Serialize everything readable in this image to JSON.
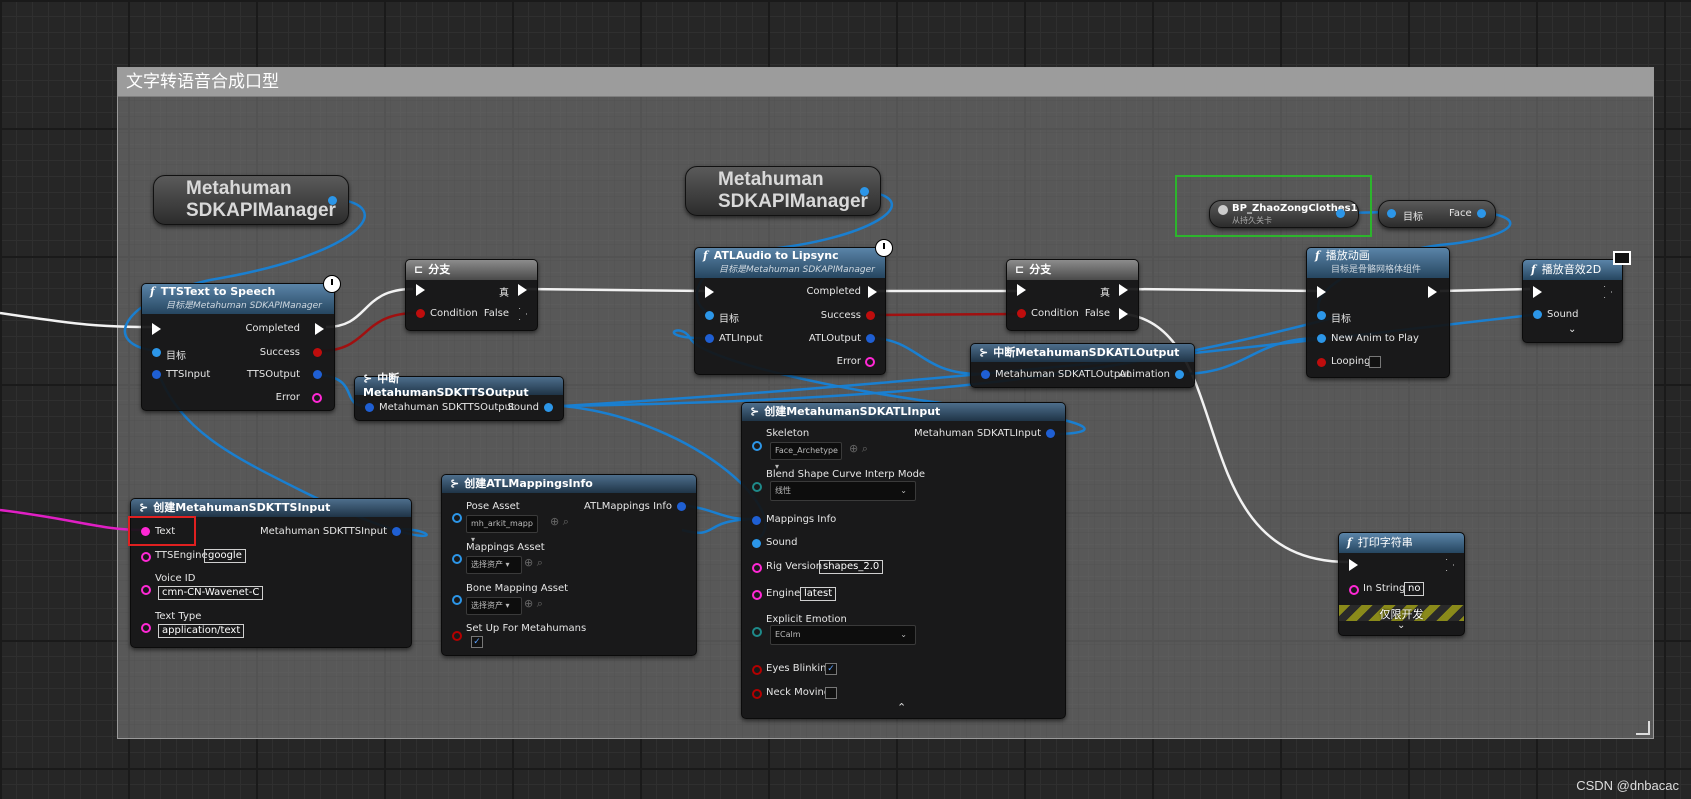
{
  "comment_title": "文字转语音合成口型",
  "watermark": "CSDN @dnbacac",
  "colors": {
    "exec": "#ffffff",
    "object": "#2c96e8",
    "string": "#ff28d5",
    "bool": "#bf0d0d",
    "struct": "#1f5fd3",
    "selection": "#2cb52c",
    "highlight": "#e02020"
  },
  "var_manager_1": {
    "line1": "Metahuman",
    "line2": "SDKAPIManager"
  },
  "var_manager_2": {
    "line1": "Metahuman",
    "line2": "SDKAPIManager"
  },
  "var_clothes": {
    "name": "BP_ZhaoZongClothes1",
    "sub": "从持久关卡"
  },
  "get_face": {
    "target": "目标",
    "out": "Face"
  },
  "tts_node": {
    "title": "TTSText to Speech",
    "subtitle": "目标是Metahuman SDKAPIManager",
    "completed": "Completed",
    "target": "目标",
    "success": "Success",
    "input": "TTSInput",
    "output": "TTSOutput",
    "error": "Error"
  },
  "branch1": {
    "title": "分支",
    "true": "真",
    "condition": "Condition",
    "false": "False"
  },
  "break_tts": {
    "title": "中断MetahumanSDKTTSOutput",
    "in": "Metahuman SDKTTSOutput",
    "out": "Sound"
  },
  "make_tts_input": {
    "title": "创建MetahumanSDKTTSInput",
    "text": "Text",
    "out": "Metahuman SDKTTSInput",
    "engine_label": "TTSEngine",
    "engine": "google",
    "voice_label": "Voice ID",
    "voice": "cmn-CN-Wavenet-C",
    "type_label": "Text Type",
    "type": "application/text"
  },
  "make_mappings": {
    "title": "创建ATLMappingsInfo",
    "pose_label": "Pose Asset",
    "pose": "mh_arkit_mapp",
    "out": "ATLMappings Info",
    "map_label": "Mappings Asset",
    "map": "选择资产",
    "bone_label": "Bone Mapping Asset",
    "bone": "选择资产",
    "setup": "Set Up For Metahumans"
  },
  "atl_node": {
    "title": "ATLAudio to Lipsync",
    "subtitle": "目标是Metahuman SDKAPIManager",
    "completed": "Completed",
    "target": "目标",
    "success": "Success",
    "input": "ATLInput",
    "output": "ATLOutput",
    "error": "Error"
  },
  "branch2": {
    "title": "分支",
    "true": "真",
    "condition": "Condition",
    "false": "False"
  },
  "break_atl": {
    "title": "中断MetahumanSDKATLOutput",
    "in": "Metahuman SDKATLOutput",
    "out": "Animation"
  },
  "make_atl_input": {
    "title": "创建MetahumanSDKATLInput",
    "skeleton": "Skeleton",
    "skeleton_val": "Face_Archetype",
    "out": "Metahuman SDKATLInput",
    "blend": "Blend Shape Curve Interp Mode",
    "blend_val": "线性",
    "mappings": "Mappings Info",
    "sound": "Sound",
    "rig_label": "Rig Version",
    "rig": "shapes_2.0",
    "engine_label": "Engine",
    "engine": "latest",
    "emotion_label": "Explicit Emotion",
    "emotion": "ECalm",
    "eyes": "Eyes Blinking",
    "neck": "Neck Moving"
  },
  "play_anim": {
    "title": "播放动画",
    "subtitle": "目标是骨骼网格体组件",
    "target": "目标",
    "anim": "New Anim to Play",
    "looping": "Looping"
  },
  "play_sound": {
    "title": "播放音效2D",
    "sound": "Sound"
  },
  "print_string": {
    "title": "打印字符串",
    "in_label": "In String",
    "in": "no",
    "dev": "仅限开发"
  }
}
